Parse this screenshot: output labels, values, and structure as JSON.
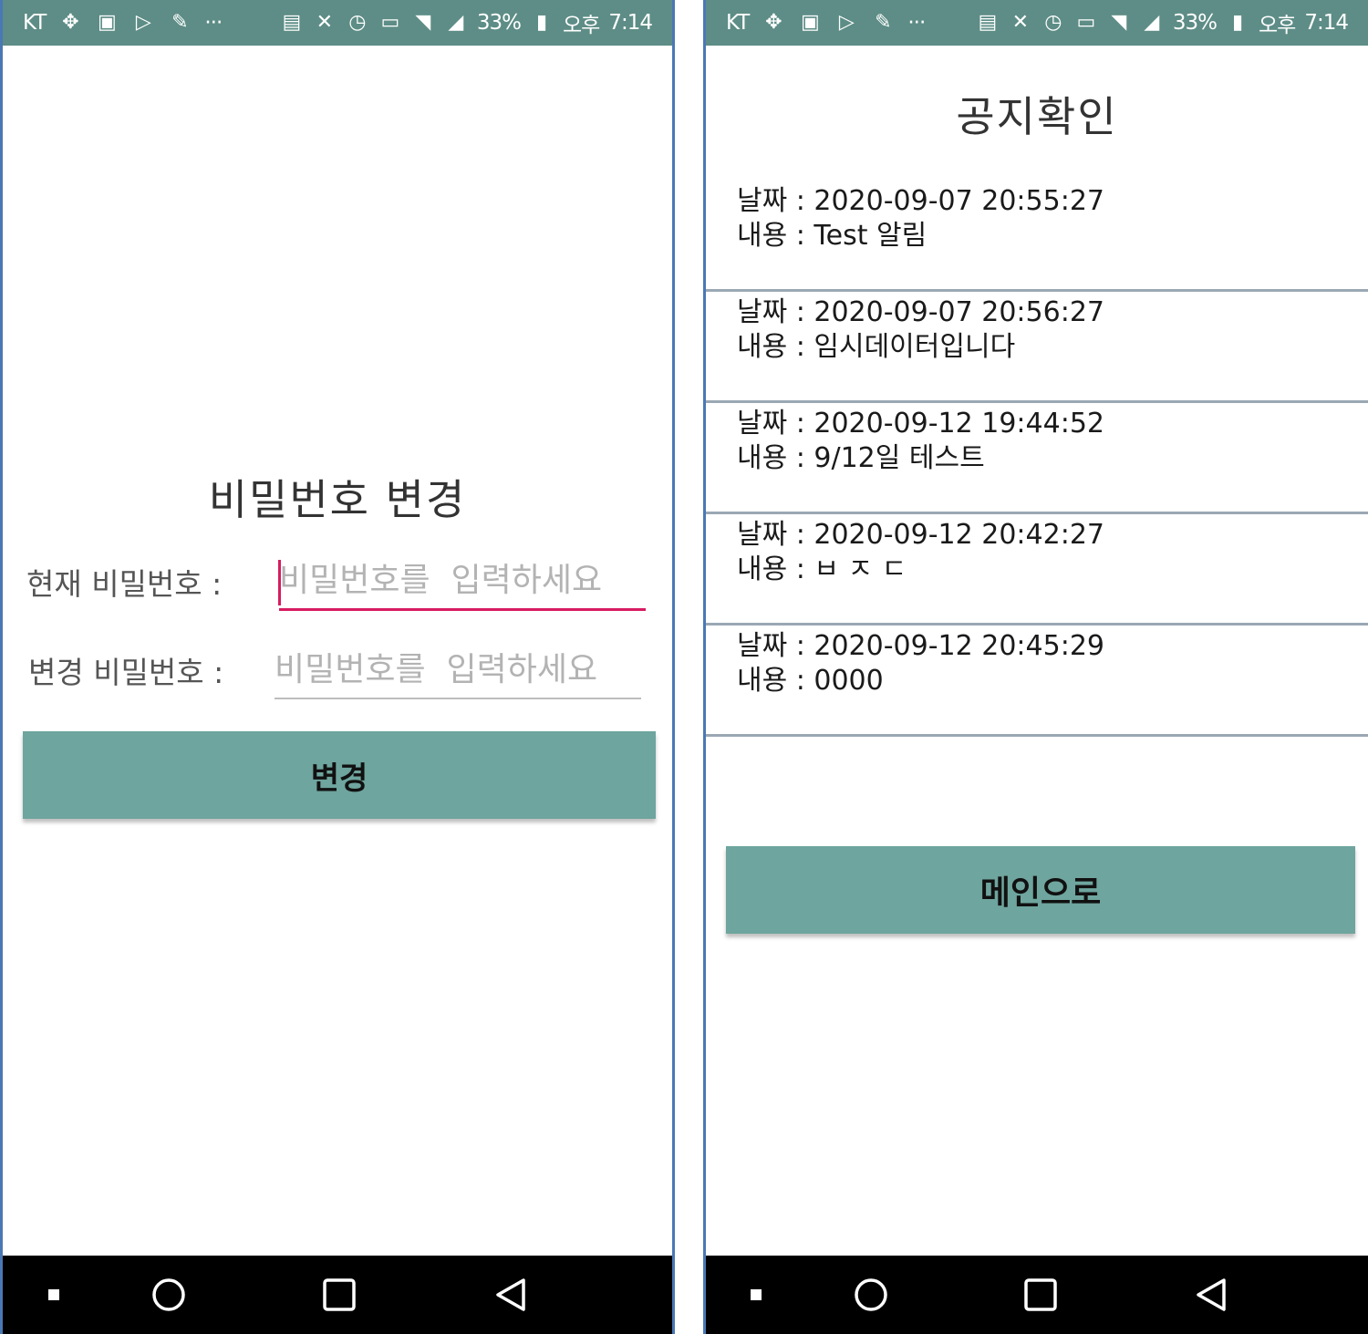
{
  "status_bar": {
    "carrier": "KT",
    "battery": "33%",
    "ampm": "오후",
    "time": "7:14",
    "left_icons": [
      "location-icon",
      "gallery-icon",
      "play-store-icon",
      "clip-icon"
    ],
    "more": "···",
    "right_icons": [
      "nfc-icon",
      "mute-icon",
      "alarm-icon",
      "message-icon",
      "wifi-icon",
      "signal-icon",
      "battery-icon"
    ]
  },
  "password_screen": {
    "title": "비밀번호 변경",
    "current_label": "현재 비밀번호 :",
    "current_placeholder": "비밀번호를  입력하세요",
    "new_label": "변경 비밀번호 :",
    "new_placeholder": "비밀번호를  입력하세요",
    "button_label": "변경"
  },
  "notice_screen": {
    "title": "공지확인",
    "items": [
      {
        "date_line": "날짜 : 2020-09-07 20:55:27",
        "content_line": "내용 : Test 알림"
      },
      {
        "date_line": "날짜 : 2020-09-07 20:56:27",
        "content_line": "내용 : 임시데이터입니다"
      },
      {
        "date_line": "날짜 : 2020-09-12 19:44:52",
        "content_line": "내용 : 9/12일 테스트"
      },
      {
        "date_line": "날짜 : 2020-09-12 20:42:27",
        "content_line": "내용 : ㅂ ㅈ ㄷ"
      },
      {
        "date_line": "날짜 : 2020-09-12 20:45:29",
        "content_line": "내용 : 0000"
      }
    ],
    "button_label": "메인으로"
  },
  "nav_bar": {
    "buttons": [
      "recents-dot-icon",
      "home-icon",
      "overview-icon",
      "back-icon"
    ]
  },
  "colors": {
    "status_bar": "#5d8d86",
    "button": "#6ea59e",
    "input_focus": "#d81b60",
    "nav_bar": "#000000"
  }
}
